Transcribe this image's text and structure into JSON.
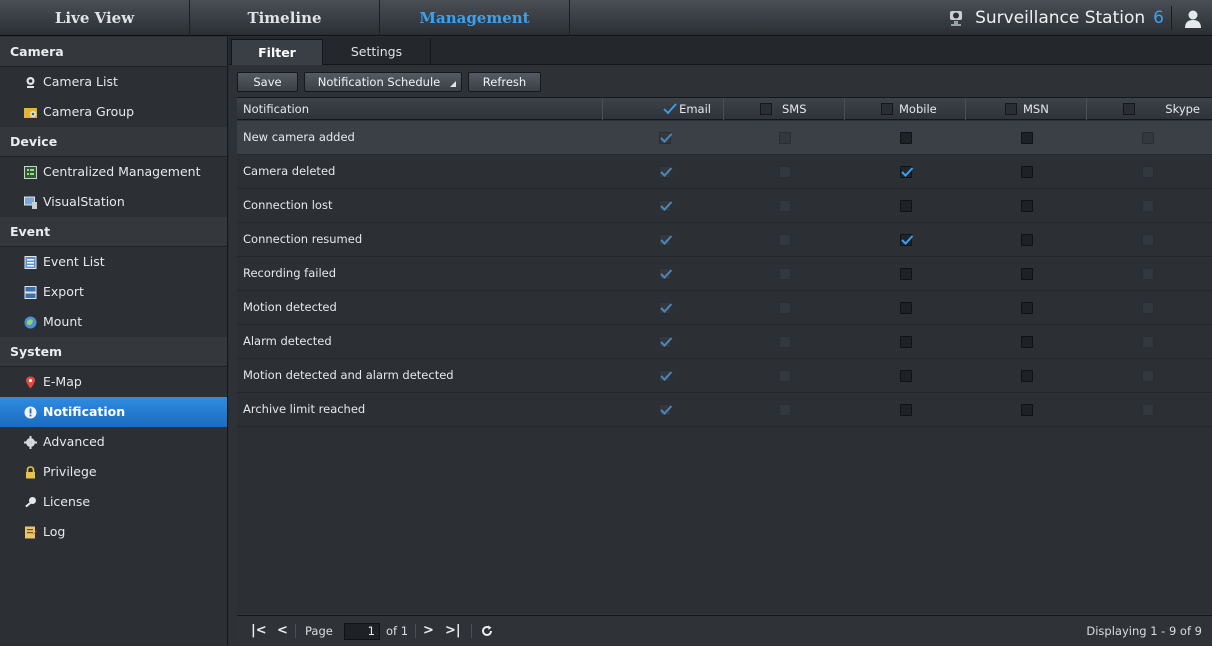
{
  "top_tabs": [
    "Live View",
    "Timeline",
    "Management"
  ],
  "brand": {
    "name": "Surveillance Station",
    "version": "6"
  },
  "sidebar": {
    "sections": [
      {
        "title": "Camera",
        "items": [
          "Camera List",
          "Camera Group"
        ]
      },
      {
        "title": "Device",
        "items": [
          "Centralized Management",
          "VisualStation"
        ]
      },
      {
        "title": "Event",
        "items": [
          "Event List",
          "Export",
          "Mount"
        ]
      },
      {
        "title": "System",
        "items": [
          "E-Map",
          "Notification",
          "Advanced",
          "Privilege",
          "License",
          "Log"
        ]
      }
    ],
    "active_item": "Notification"
  },
  "subtabs": [
    "Filter",
    "Settings"
  ],
  "toolbar": {
    "save": "Save",
    "schedule": "Notification Schedule",
    "refresh": "Refresh"
  },
  "grid": {
    "columns": [
      "Notification",
      "Email",
      "SMS",
      "Mobile",
      "MSN",
      "Skype"
    ],
    "header_checked": {
      "Email": true,
      "SMS": false,
      "Mobile": false,
      "MSN": false,
      "Skype": false
    },
    "rows": [
      {
        "name": "New camera added",
        "email": true,
        "sms": false,
        "mobile": false,
        "msn": false,
        "skype": false
      },
      {
        "name": "Camera deleted",
        "email": true,
        "sms": false,
        "mobile": true,
        "msn": false,
        "skype": false
      },
      {
        "name": "Connection lost",
        "email": true,
        "sms": false,
        "mobile": false,
        "msn": false,
        "skype": false
      },
      {
        "name": "Connection resumed",
        "email": true,
        "sms": false,
        "mobile": true,
        "msn": false,
        "skype": false
      },
      {
        "name": "Recording failed",
        "email": true,
        "sms": false,
        "mobile": false,
        "msn": false,
        "skype": false
      },
      {
        "name": "Motion detected",
        "email": true,
        "sms": false,
        "mobile": false,
        "msn": false,
        "skype": false
      },
      {
        "name": "Alarm detected",
        "email": true,
        "sms": false,
        "mobile": false,
        "msn": false,
        "skype": false
      },
      {
        "name": "Motion detected and alarm detected",
        "email": true,
        "sms": false,
        "mobile": false,
        "msn": false,
        "skype": false
      },
      {
        "name": "Archive limit reached",
        "email": true,
        "sms": false,
        "mobile": false,
        "msn": false,
        "skype": false
      }
    ]
  },
  "pager": {
    "page_label": "Page",
    "page_value": "1",
    "of_label": "of 1",
    "displaying": "Displaying 1 - 9 of 9"
  },
  "colors": {
    "accent": "#3aa1f0",
    "active_item": "#2a84d8",
    "check": "#3aa1f0"
  }
}
